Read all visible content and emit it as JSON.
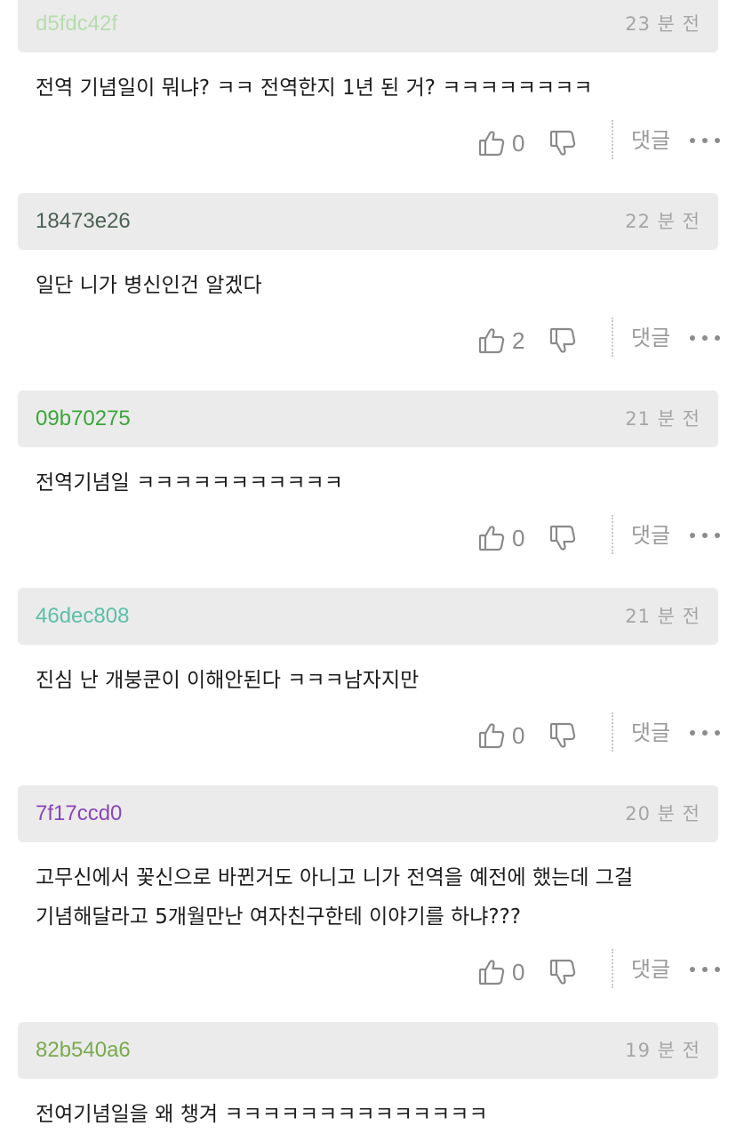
{
  "reply_label": "댓글",
  "comments": [
    {
      "author": "d5fdc42f",
      "author_color": "#b7dcae",
      "time": "23 분 전",
      "text": "전역 기념일이 뭐냐? ㅋㅋ 전역한지 1년 된 거? ㅋㅋㅋㅋㅋㅋㅋㅋ",
      "likes": "0"
    },
    {
      "author": "18473e26",
      "author_color": "#4d6155",
      "time": "22 분 전",
      "text": "일단 니가 병신인건 알겠다",
      "likes": "2"
    },
    {
      "author": "09b70275",
      "author_color": "#3aa63a",
      "time": "21 분 전",
      "text": "전역기념일 ㅋㅋㅋㅋㅋㅋㅋㅋㅋㅋㅋ",
      "likes": "0"
    },
    {
      "author": "46dec808",
      "author_color": "#5cbfa8",
      "time": "21 분 전",
      "text": "진심 난 개붕쿤이 이해안된다 ㅋㅋㅋ남자지만",
      "likes": "0"
    },
    {
      "author": "7f17ccd0",
      "author_color": "#8a46b8",
      "time": "20 분 전",
      "text": "고무신에서 꽃신으로 바뀐거도 아니고 니가 전역을 예전에 했는데 그걸 기념해달라고 5개월만난 여자친구한테 이야기를 하냐???",
      "likes": "0"
    },
    {
      "author": "82b540a6",
      "author_color": "#7aaa4e",
      "time": "19 분 전",
      "text": "전여기념일을 왜 챙겨 ㅋㅋㅋㅋㅋㅋㅋㅋㅋㅋㅋㅋㅋㅋ",
      "likes": ""
    }
  ]
}
